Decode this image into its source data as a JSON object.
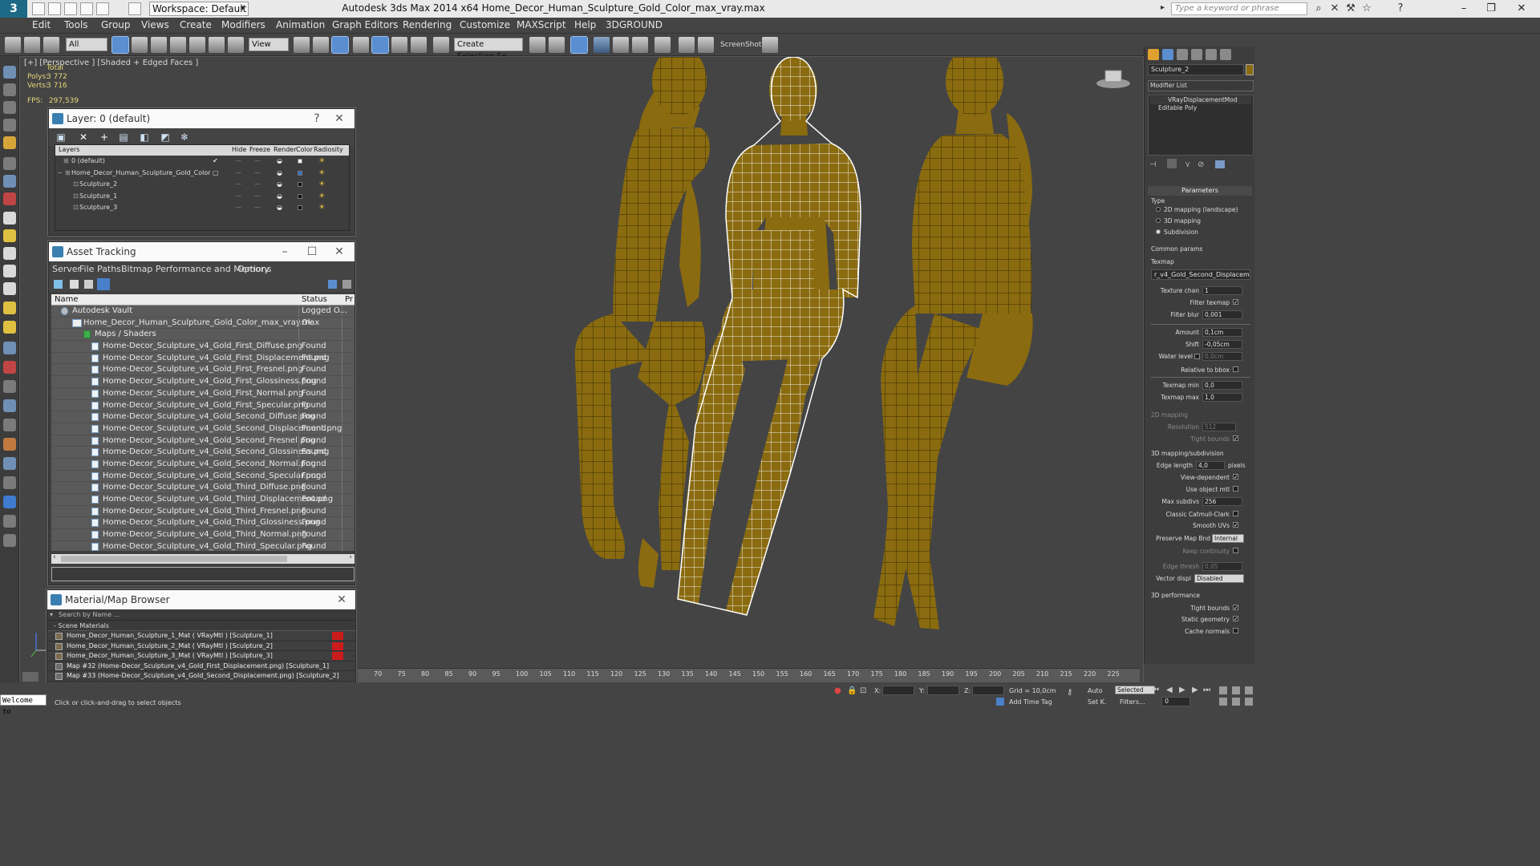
{
  "app": {
    "title": "Autodesk 3ds Max  2014 x64     Home_Decor_Human_Sculpture_Gold_Color_max_vray.max",
    "logo": "3",
    "workspace": "Workspace: Default",
    "search_placeholder": "Type a keyword or phrase"
  },
  "menu": [
    "Edit",
    "Tools",
    "Group",
    "Views",
    "Create",
    "Modifiers",
    "Animation",
    "Graph Editors",
    "Rendering",
    "Customize",
    "MAXScript",
    "Help",
    "3DGROUND"
  ],
  "toolbar": {
    "filter": "All",
    "refcoord": "View",
    "named_sel": "Create Selection Se",
    "screenshot": "ScreenShot"
  },
  "viewport": {
    "label": "[+] [Perspective ] [Shaded + Edged Faces ]",
    "stats_total": "Total",
    "polys_label": "Polys:",
    "polys": "3 772",
    "verts_label": "Verts:",
    "verts": "3 716",
    "fps_label": "FPS:",
    "fps": "297,539"
  },
  "layer_window": {
    "title": "Layer: 0 (default)",
    "help": "?",
    "columns": [
      "Layers",
      "Hide",
      "Freeze",
      "Render",
      "Color",
      "Radiosity"
    ],
    "rows": [
      {
        "name": "0 (default)",
        "indent": 0,
        "color": "#ffffff"
      },
      {
        "name": "Home_Decor_Human_Sculpture_Gold_Color",
        "indent": 0,
        "color": "#2e74d0"
      },
      {
        "name": "Sculpture_2",
        "indent": 1,
        "color": "#111111"
      },
      {
        "name": "Sculpture_1",
        "indent": 1,
        "color": "#111111"
      },
      {
        "name": "Sculpture_3",
        "indent": 1,
        "color": "#111111"
      }
    ]
  },
  "asset_window": {
    "title": "Asset Tracking",
    "menu": [
      "Server",
      "File",
      "Paths",
      "Bitmap Performance and Memory",
      "Options"
    ],
    "col_name": "Name",
    "col_status": "Status",
    "col_pr": "Pr",
    "rows": [
      {
        "name": "Autodesk Vault",
        "status": "Logged O...",
        "level": 0,
        "kind": "vault"
      },
      {
        "name": "Home_Decor_Human_Sculpture_Gold_Color_max_vray.max",
        "status": "Ok",
        "level": 1,
        "kind": "max"
      },
      {
        "name": "Maps / Shaders",
        "status": "",
        "level": 2,
        "kind": "maps"
      },
      {
        "name": "Home-Decor_Sculpture_v4_Gold_First_Diffuse.png",
        "status": "Found",
        "level": 3,
        "kind": "file"
      },
      {
        "name": "Home-Decor_Sculpture_v4_Gold_First_Displacement.png",
        "status": "Found",
        "level": 3,
        "kind": "file"
      },
      {
        "name": "Home-Decor_Sculpture_v4_Gold_First_Fresnel.png",
        "status": "Found",
        "level": 3,
        "kind": "file"
      },
      {
        "name": "Home-Decor_Sculpture_v4_Gold_First_Glossiness.png",
        "status": "Found",
        "level": 3,
        "kind": "file"
      },
      {
        "name": "Home-Decor_Sculpture_v4_Gold_First_Normal.png",
        "status": "Found",
        "level": 3,
        "kind": "file"
      },
      {
        "name": "Home-Decor_Sculpture_v4_Gold_First_Specular.png",
        "status": "Found",
        "level": 3,
        "kind": "file"
      },
      {
        "name": "Home-Decor_Sculpture_v4_Gold_Second_Diffuse.png",
        "status": "Found",
        "level": 3,
        "kind": "file"
      },
      {
        "name": "Home-Decor_Sculpture_v4_Gold_Second_Displacement.png",
        "status": "Found",
        "level": 3,
        "kind": "file"
      },
      {
        "name": "Home-Decor_Sculpture_v4_Gold_Second_Fresnel.png",
        "status": "Found",
        "level": 3,
        "kind": "file"
      },
      {
        "name": "Home-Decor_Sculpture_v4_Gold_Second_Glossiness.png",
        "status": "Found",
        "level": 3,
        "kind": "file"
      },
      {
        "name": "Home-Decor_Sculpture_v4_Gold_Second_Normal.png",
        "status": "Found",
        "level": 3,
        "kind": "file"
      },
      {
        "name": "Home-Decor_Sculpture_v4_Gold_Second_Specular.png",
        "status": "Found",
        "level": 3,
        "kind": "file"
      },
      {
        "name": "Home-Decor_Sculpture_v4_Gold_Third_Diffuse.png",
        "status": "Found",
        "level": 3,
        "kind": "file"
      },
      {
        "name": "Home-Decor_Sculpture_v4_Gold_Third_Displacement.png",
        "status": "Found",
        "level": 3,
        "kind": "file"
      },
      {
        "name": "Home-Decor_Sculpture_v4_Gold_Third_Fresnel.png",
        "status": "Found",
        "level": 3,
        "kind": "file"
      },
      {
        "name": "Home-Decor_Sculpture_v4_Gold_Third_Glossiness.png",
        "status": "Found",
        "level": 3,
        "kind": "file"
      },
      {
        "name": "Home-Decor_Sculpture_v4_Gold_Third_Normal.png",
        "status": "Found",
        "level": 3,
        "kind": "file"
      },
      {
        "name": "Home-Decor_Sculpture_v4_Gold_Third_Specular.png",
        "status": "Found",
        "level": 3,
        "kind": "file"
      }
    ]
  },
  "material_browser": {
    "title": "Material/Map Browser",
    "search": "Search by Name ...",
    "group": "- Scene Materials",
    "rows": [
      {
        "label": "Home_Decor_Human_Sculpture_1_Mat  ( VRayMtl )  [Sculpture_1]",
        "kind": "mat"
      },
      {
        "label": "Home_Decor_Human_Sculpture_2_Mat  ( VRayMtl )  [Sculpture_2]",
        "kind": "mat"
      },
      {
        "label": "Home_Decor_Human_Sculpture_3_Mat  ( VRayMtl )  [Sculpture_3]",
        "kind": "mat"
      },
      {
        "label": "Map #32 (Home-Decor_Sculpture_v4_Gold_First_Displacement.png)  [Sculpture_1]",
        "kind": "map"
      },
      {
        "label": "Map #33 (Home-Decor_Sculpture_v4_Gold_Second_Displacement.png)  [Sculpture_2]",
        "kind": "map"
      },
      {
        "label": "Map #34 (Home-Decor_Sculpture_v4_Gold_Third_Displacement.png)  [Sculpture_3]",
        "kind": "map"
      }
    ]
  },
  "command_panel": {
    "object_name": "Sculpture_2",
    "modifier_list": "Modifier List",
    "stack": [
      "VRayDisplacementMod",
      "Editable Poly"
    ],
    "rollout": "Parameters",
    "type_label": "Type",
    "type_options": [
      "2D mapping (landscape)",
      "3D mapping",
      "Subdivision"
    ],
    "common_params": "Common params",
    "texmap_label": "Texmap",
    "texmap_value": "r_v4_Gold_Second_Displacement.png)",
    "texture_chan_label": "Texture chan",
    "texture_chan": "1",
    "filter_texmap": "Filter texmap",
    "filter_blur_label": "Filter blur",
    "filter_blur": "0,001",
    "amount_label": "Amount",
    "amount": "0,1cm",
    "shift_label": "Shift",
    "shift": "-0,05cm",
    "water_level_label": "Water level",
    "water_level": "0,0cm",
    "relative_bbox": "Relative to bbox",
    "texmap_min_label": "Texmap min",
    "texmap_min": "0,0",
    "texmap_max_label": "Texmap max",
    "texmap_max": "1,0",
    "map2d_label": "2D mapping",
    "resolution_label": "Resolution",
    "resolution": "512",
    "tight_bounds": "Tight bounds",
    "map3d_label": "3D mapping/subdivision",
    "edge_length_label": "Edge length",
    "edge_length": "4,0",
    "pixels": "pixels",
    "view_dependent": "View-dependent",
    "use_object_mtl": "Use object mtl",
    "max_subdivs_label": "Max subdivs",
    "max_subdivs": "256",
    "classic_cc": "Classic Catmull-Clark",
    "smooth_uvs": "Smooth UVs",
    "preserve_map_label": "Preserve Map Bnd",
    "preserve_map": "Internal",
    "keep_continuity": "Keep continuity",
    "edge_thresh_label": "Edge thresh",
    "edge_thresh": "0,05",
    "vector_disp_label": "Vector displ",
    "vector_disp": "Disabled",
    "perf_label": "3D performance",
    "perf_tight": "Tight bounds",
    "static_geo": "Static geometry",
    "cache_normals": "Cache normals"
  },
  "timeline": {
    "ticks": [
      "70",
      "75",
      "80",
      "85",
      "90",
      "95",
      "100",
      "105",
      "110",
      "115",
      "120",
      "125",
      "130",
      "135",
      "140",
      "145",
      "150",
      "155",
      "160",
      "165",
      "170",
      "175",
      "180",
      "185",
      "190",
      "195",
      "200",
      "205",
      "210",
      "215",
      "220",
      "225"
    ]
  },
  "status": {
    "welcome": "Welcome to",
    "prompt": "Click or click-and-drag to select objects",
    "x": "X:",
    "y": "Y:",
    "z": "Z:",
    "grid": "Grid = 10,0cm",
    "add_time_tag": "Add Time Tag",
    "auto": "Auto",
    "selected": "Selected",
    "setk": "Set K.",
    "filters": "Filters...",
    "frame": "0"
  },
  "colors": {
    "sculpture_gold": "#8a6b10",
    "wire_dark": "#2a2100",
    "wire_selected": "#ffffff",
    "viewport_bg": "#444444"
  }
}
